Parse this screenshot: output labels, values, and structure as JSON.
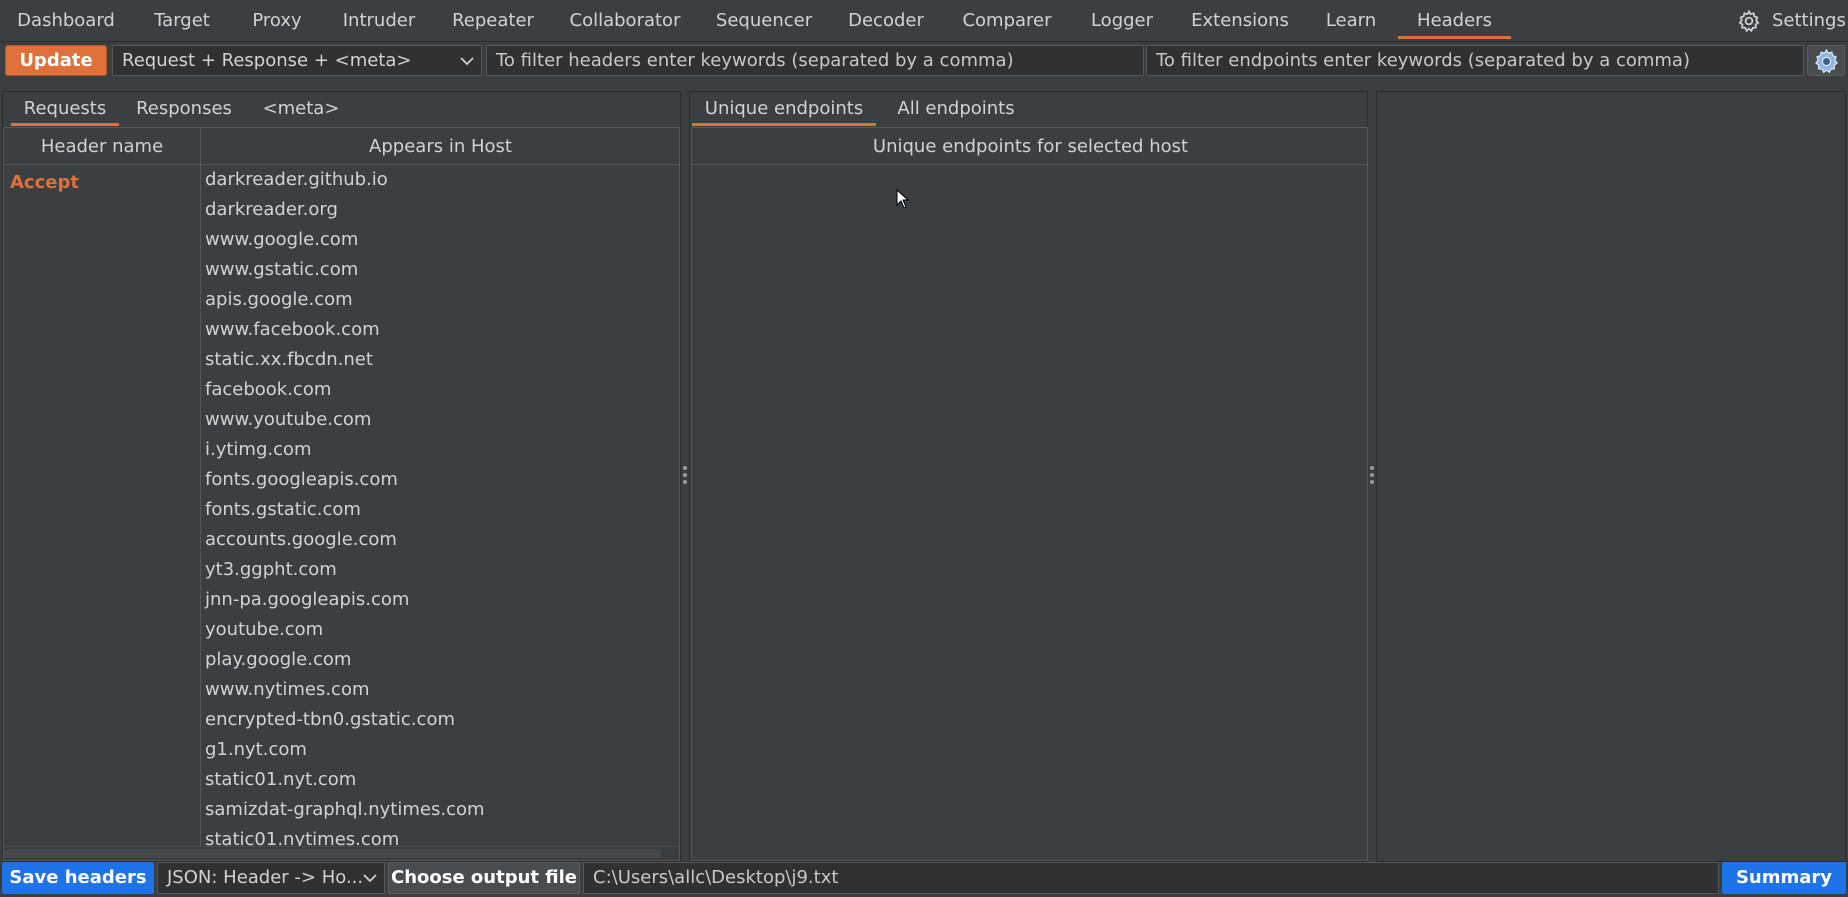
{
  "nav": {
    "items": [
      {
        "label": "Dashboard"
      },
      {
        "label": "Target"
      },
      {
        "label": "Proxy"
      },
      {
        "label": "Intruder"
      },
      {
        "label": "Repeater"
      },
      {
        "label": "Collaborator"
      },
      {
        "label": "Sequencer"
      },
      {
        "label": "Decoder"
      },
      {
        "label": "Comparer"
      },
      {
        "label": "Logger"
      },
      {
        "label": "Extensions"
      },
      {
        "label": "Learn"
      },
      {
        "label": "Headers"
      }
    ],
    "active": "Headers",
    "settings_label": "Settings"
  },
  "toolbar": {
    "update_label": "Update",
    "mode_select": "Request + Response + <meta>",
    "headers_filter_placeholder": "To filter headers enter keywords (separated by a comma)",
    "endpoints_filter_placeholder": "To filter endpoints enter keywords (separated by a comma)"
  },
  "left_panel": {
    "tabs": [
      {
        "label": "Requests"
      },
      {
        "label": "Responses"
      },
      {
        "label": "<meta>"
      }
    ],
    "active_tab": "Requests",
    "columns": [
      "Header name",
      "Appears in Host"
    ],
    "header_name": "Accept",
    "hosts": [
      "darkreader.github.io",
      "darkreader.org",
      "www.google.com",
      "www.gstatic.com",
      "apis.google.com",
      "www.facebook.com",
      "static.xx.fbcdn.net",
      "facebook.com",
      "www.youtube.com",
      "i.ytimg.com",
      "fonts.googleapis.com",
      "fonts.gstatic.com",
      "accounts.google.com",
      "yt3.ggpht.com",
      "jnn-pa.googleapis.com",
      "youtube.com",
      "play.google.com",
      "www.nytimes.com",
      "encrypted-tbn0.gstatic.com",
      "g1.nyt.com",
      "static01.nyt.com",
      "samizdat-graphql.nytimes.com",
      "static01.nytimes.com"
    ]
  },
  "mid_panel": {
    "tabs": [
      {
        "label": "Unique endpoints"
      },
      {
        "label": "All endpoints"
      }
    ],
    "active_tab": "Unique endpoints",
    "column": "Unique endpoints for selected host"
  },
  "bottom": {
    "save_label": "Save headers",
    "format_select": "JSON: Header -> Ho...",
    "choose_output_label": "Choose output file",
    "output_path": "C:\\Users\\allc\\Desktop\\j9.txt",
    "summary_label": "Summary"
  },
  "colors": {
    "accent": "#e0703a",
    "primary_button": "#1e73e8",
    "background": "#3c3f41"
  }
}
